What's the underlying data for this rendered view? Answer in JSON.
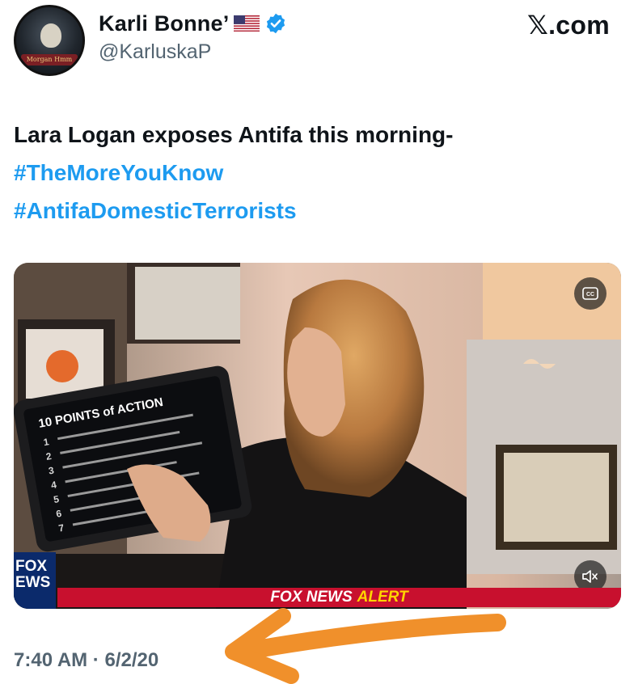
{
  "author": {
    "display_name": "Karli Bonne’",
    "handle": "@KarluskaP",
    "avatar_caption": "Morgan Hmm"
  },
  "site_label": "𝕏.com",
  "tweet": {
    "text_line": "Lara Logan exposes Antifa this morning-",
    "hashtags": [
      "#TheMoreYouKnow",
      "#AntifaDomesticTerrorists"
    ],
    "timestamp": "7:40 AM · 6/2/20"
  },
  "media": {
    "tablet_title": "10 POINTS of ACTION",
    "tablet_numbers": [
      "1",
      "2",
      "3",
      "4",
      "5",
      "6",
      "7"
    ],
    "ticker_brand": "FOX NEWS",
    "ticker_alert": "ALERT",
    "logo_text_top": "FOX",
    "logo_text_bottom": "EWS"
  },
  "icons": {
    "verified": "verified-badge-icon",
    "flag": "us-flag-icon",
    "captions": "closed-captions-icon",
    "volume": "volume-muted-icon"
  },
  "colors": {
    "hashtag": "#1d9bf0",
    "verified": "#1d9bf0",
    "ticker_red": "#c8102e",
    "ticker_yellow": "#ffd400",
    "annotation_arrow": "#f0902b",
    "secondary_text": "#536471"
  }
}
